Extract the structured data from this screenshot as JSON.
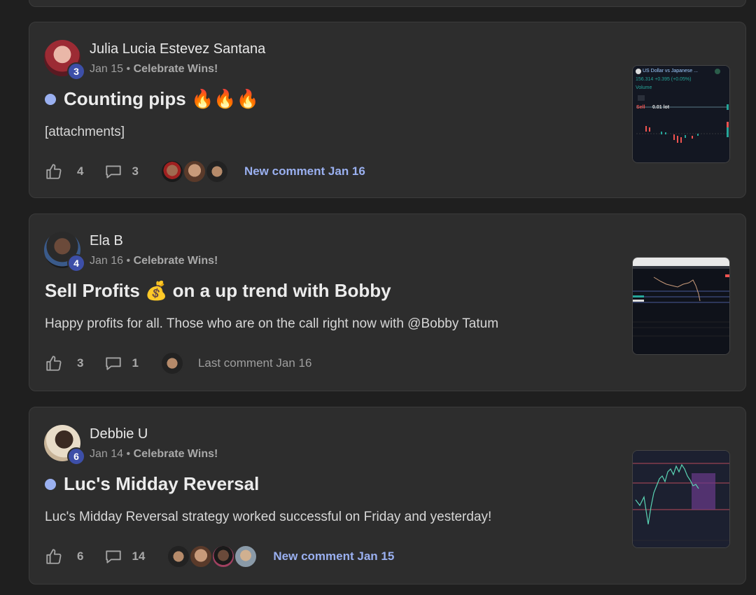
{
  "posts": [
    {
      "author": "Julia Lucia Estevez Santana",
      "level": "3",
      "date": "Jan 15",
      "separator": "•",
      "category": "Celebrate Wins!",
      "title": "Counting pips 🔥🔥🔥",
      "unread": true,
      "body": "[attachments]",
      "likes": "4",
      "comments": "3",
      "activity": "New comment Jan 16",
      "activity_type": "new",
      "thumb_header": "US Dollar vs Japanese ...",
      "thumb_price": "156.314  +0.395 (+0.05%)",
      "thumb_volume": "Volume",
      "thumb_sell": "Sell",
      "thumb_lot": "0.01 lot"
    },
    {
      "author": "Ela B",
      "level": "4",
      "date": "Jan 16",
      "separator": "•",
      "category": "Celebrate Wins!",
      "title": "Sell Profits 💰 on a up trend with Bobby",
      "unread": false,
      "body": "Happy profits for all. Those who are on the call right now with @Bobby Tatum",
      "likes": "3",
      "comments": "1",
      "activity": "Last comment Jan 16",
      "activity_type": "last"
    },
    {
      "author": "Debbie U",
      "level": "6",
      "date": "Jan 14",
      "separator": "•",
      "category": "Celebrate Wins!",
      "title": "Luc's Midday Reversal",
      "unread": true,
      "body": "Luc's Midday Reversal strategy worked successful on Friday and yesterday!",
      "likes": "6",
      "comments": "14",
      "activity": "New comment Jan 15",
      "activity_type": "new"
    }
  ],
  "colors": {
    "background": "#1f1f1f",
    "card": "#2d2d2d",
    "accent": "#9ab0f0",
    "level_badge": "#3d4fa8"
  },
  "icons": {
    "like": "thumbs-up-icon",
    "comment": "comment-bubble-icon"
  }
}
